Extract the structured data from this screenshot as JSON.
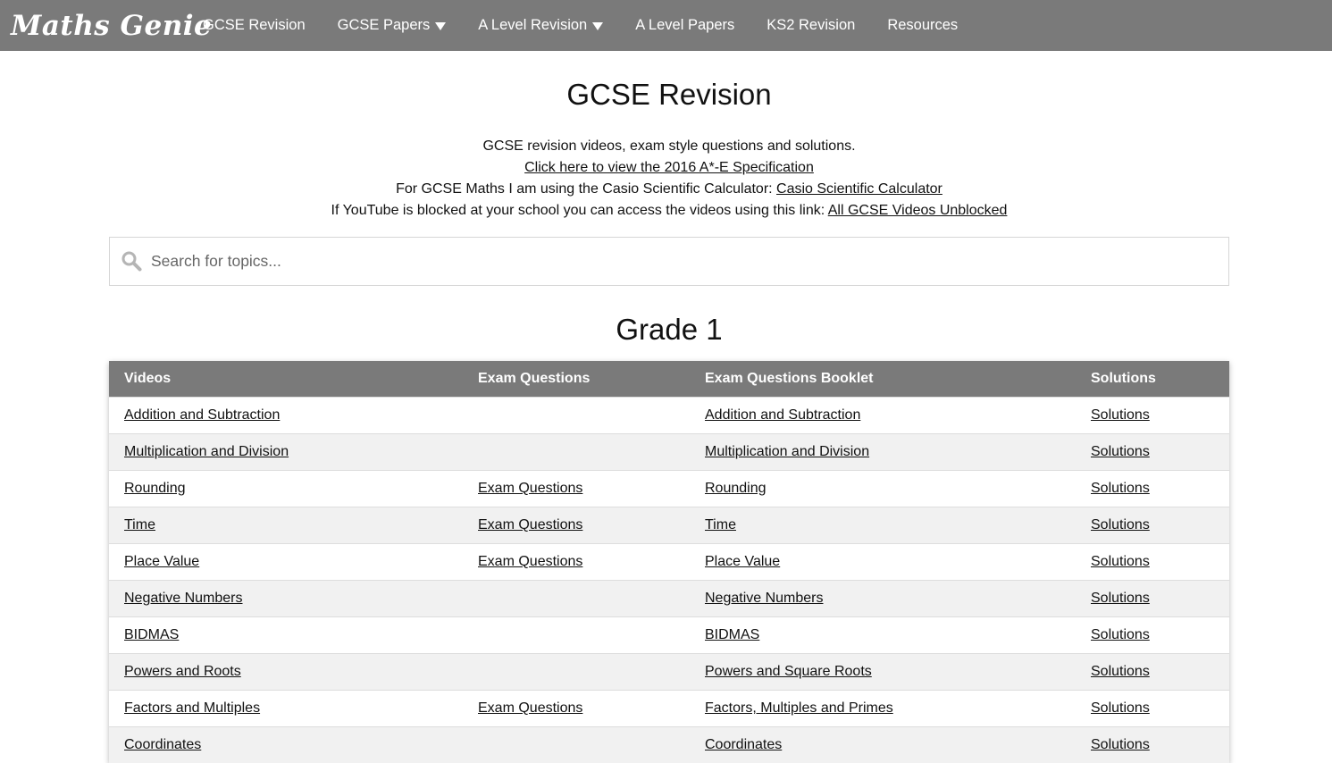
{
  "nav": {
    "logo": "Maths Genie",
    "items": [
      {
        "label": "GCSE Revision"
      },
      {
        "label": "GCSE Papers"
      },
      {
        "label": "A Level Revision"
      },
      {
        "label": "A Level Papers"
      },
      {
        "label": "KS2 Revision"
      },
      {
        "label": "Resources"
      }
    ]
  },
  "page": {
    "title": "GCSE Revision",
    "intro_line1": "GCSE revision videos, exam style questions and solutions.",
    "spec_link": "Click here to view the 2016 A*-E Specification",
    "calc_text": "For GCSE Maths I am using the Casio Scientific Calculator: ",
    "calc_link": "Casio Scientific Calculator",
    "youtube_text": "If YouTube is blocked at your school you can access the videos using this link: ",
    "youtube_link": "All GCSE Videos Unblocked"
  },
  "search": {
    "placeholder": "Search for topics..."
  },
  "grade": {
    "heading": "Grade 1",
    "headers": {
      "videos": "Videos",
      "exam_questions": "Exam Questions",
      "booklet": "Exam Questions Booklet",
      "solutions": "Solutions"
    },
    "rows": [
      {
        "video": "Addition and Subtraction",
        "exam": "",
        "booklet": "Addition and Subtraction",
        "solutions": "Solutions"
      },
      {
        "video": "Multiplication and Division",
        "exam": "",
        "booklet": "Multiplication and Division",
        "solutions": "Solutions"
      },
      {
        "video": "Rounding",
        "exam": "Exam Questions",
        "booklet": "Rounding",
        "solutions": "Solutions"
      },
      {
        "video": "Time",
        "exam": "Exam Questions",
        "booklet": "Time",
        "solutions": "Solutions"
      },
      {
        "video": "Place Value",
        "exam": "Exam Questions",
        "booklet": "Place Value",
        "solutions": "Solutions"
      },
      {
        "video": "Negative Numbers",
        "exam": "",
        "booklet": "Negative Numbers",
        "solutions": "Solutions"
      },
      {
        "video": "BIDMAS",
        "exam": "",
        "booklet": "BIDMAS",
        "solutions": "Solutions"
      },
      {
        "video": "Powers and Roots",
        "exam": "",
        "booklet": "Powers and Square Roots",
        "solutions": "Solutions"
      },
      {
        "video": "Factors and Multiples",
        "exam": "Exam Questions",
        "booklet": "Factors, Multiples and Primes",
        "solutions": "Solutions"
      },
      {
        "video": "Coordinates",
        "exam": "",
        "booklet": "Coordinates",
        "solutions": "Solutions"
      }
    ]
  },
  "colors": {
    "nav_bg": "#7a7a7a",
    "row_alt": "#f1f1f1"
  }
}
